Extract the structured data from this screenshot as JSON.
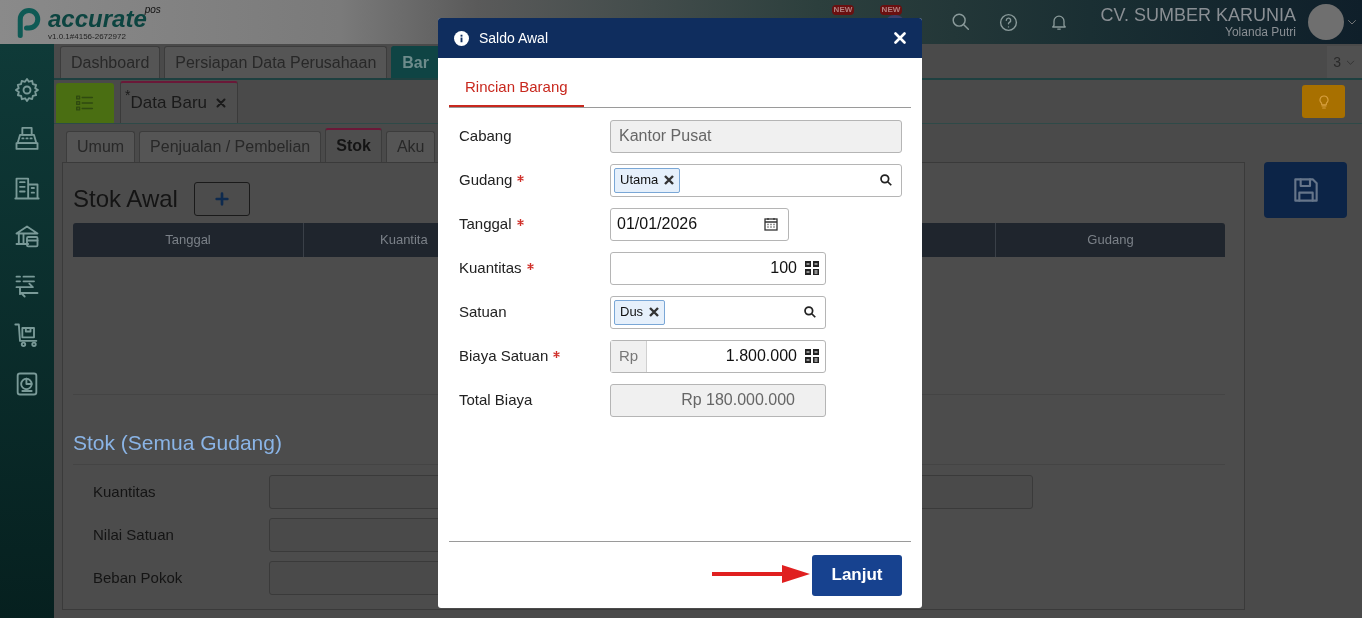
{
  "header": {
    "logo_text": "accurate",
    "logo_superscript": "pos",
    "version": "v1.0.1#4156-2672972",
    "new_badges": [
      "NEW",
      "NEW"
    ],
    "company": "CV. SUMBER KARUNIA",
    "user": "Yolanda Putri"
  },
  "main_tabs": [
    {
      "label": "Dashboard",
      "selected": false
    },
    {
      "label": "Persiapan Data Perusahaan",
      "selected": false
    },
    {
      "label": "Bar",
      "selected": true
    }
  ],
  "tab_count": "3",
  "document_tab": {
    "modified_mark": "*",
    "label": "Data Baru"
  },
  "section_tabs": [
    {
      "label": "Umum",
      "selected": false
    },
    {
      "label": "Penjualan / Pembelian",
      "selected": false
    },
    {
      "label": "Stok",
      "selected": true
    },
    {
      "label": "Aku",
      "selected": false
    }
  ],
  "stock": {
    "title": "Stok Awal",
    "columns": [
      "Tanggal",
      "Kuantita",
      "Gudang"
    ],
    "summary_title": "Stok (Semua Gudang)",
    "summary_fields": [
      "Kuantitas",
      "Nilai Satuan",
      "Beban Pokok"
    ]
  },
  "dialog": {
    "title": "Saldo Awal",
    "tabs": [
      {
        "label": "Rincian Barang",
        "selected": true
      }
    ],
    "fields": [
      {
        "kind": "text",
        "label": "Cabang",
        "value": "Kantor Pusat",
        "required": false,
        "disabled": true
      },
      {
        "kind": "chips",
        "label": "Gudang",
        "chips": [
          "Utama"
        ],
        "required": true,
        "disabled": false
      },
      {
        "kind": "date",
        "label": "Tanggal",
        "value": "01/01/2026",
        "required": true,
        "disabled": false
      },
      {
        "kind": "number",
        "label": "Kuantitas",
        "value": "100",
        "required": true,
        "disabled": false
      },
      {
        "kind": "chips",
        "label": "Satuan",
        "chips": [
          "Dus"
        ],
        "required": false,
        "disabled": false
      },
      {
        "kind": "currency",
        "label": "Biaya Satuan",
        "prefix": "Rp",
        "value": "1.800.000",
        "required": true,
        "disabled": false
      },
      {
        "kind": "total",
        "label": "Total Biaya",
        "value": "Rp 180.000.000",
        "required": false,
        "disabled": true
      }
    ],
    "primary_button": "Lanjut"
  }
}
